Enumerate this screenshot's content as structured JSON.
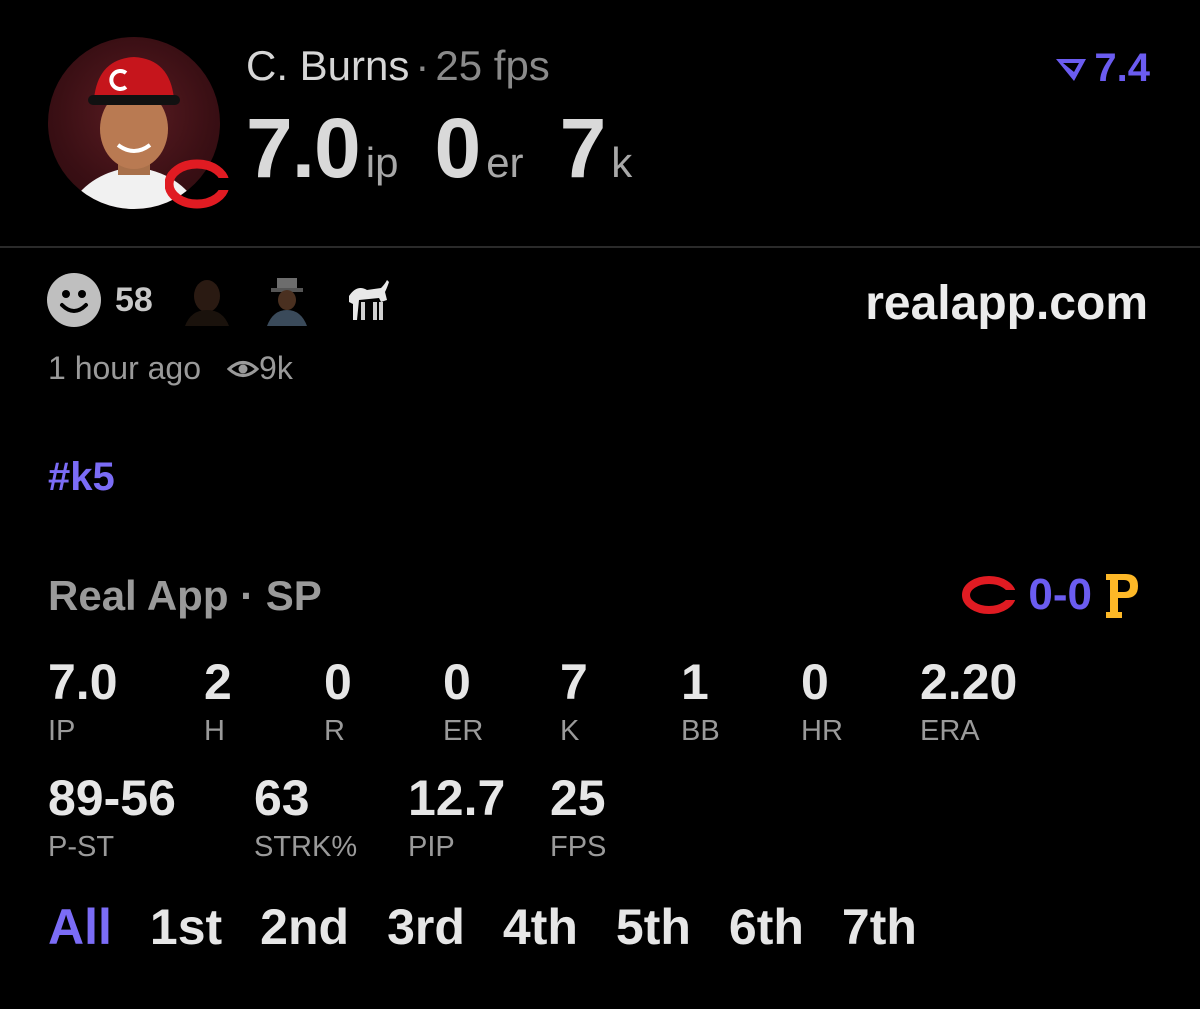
{
  "player": {
    "name": "C. Burns",
    "fps_label": "25 fps",
    "separator": "·"
  },
  "headline": {
    "ip_value": "7.0",
    "ip_unit": "ip",
    "er_value": "0",
    "er_unit": "er",
    "k_value": "7",
    "k_unit": "k"
  },
  "rating": {
    "value": "7.4",
    "icon": "real-logo-icon",
    "color": "#6b5cf0"
  },
  "reactions": {
    "count": "58",
    "icons": [
      "smiley-reaction-icon",
      "person-emoji-icon",
      "person-with-hat-emoji-icon",
      "goat-emoji-icon"
    ]
  },
  "site": "realapp.com",
  "meta": {
    "time_ago": "1 hour ago",
    "views": "9k"
  },
  "hashtag": "#k5",
  "game": {
    "label": "Real App · SP",
    "score": "0-0",
    "home_team_icon": "reds-c-logo-icon",
    "away_team_icon": "pirates-p-logo-icon",
    "accent": "#6b5cf0",
    "reds_red": "#e01b22",
    "pirates_gold": "#fdb827"
  },
  "stats_row1": [
    {
      "value": "7.0",
      "label": "IP"
    },
    {
      "value": "2",
      "label": "H"
    },
    {
      "value": "0",
      "label": "R"
    },
    {
      "value": "0",
      "label": "ER"
    },
    {
      "value": "7",
      "label": "K"
    },
    {
      "value": "1",
      "label": "BB"
    },
    {
      "value": "0",
      "label": "HR"
    },
    {
      "value": "2.20",
      "label": "ERA"
    }
  ],
  "stats_row2": [
    {
      "value": "89-56",
      "label": "P-ST"
    },
    {
      "value": "63",
      "label": "STRK%"
    },
    {
      "value": "12.7",
      "label": "PIP"
    },
    {
      "value": "25",
      "label": "FPS"
    }
  ],
  "innings_tabs": [
    "All",
    "1st",
    "2nd",
    "3rd",
    "4th",
    "5th",
    "6th",
    "7th"
  ],
  "active_tab": "All"
}
